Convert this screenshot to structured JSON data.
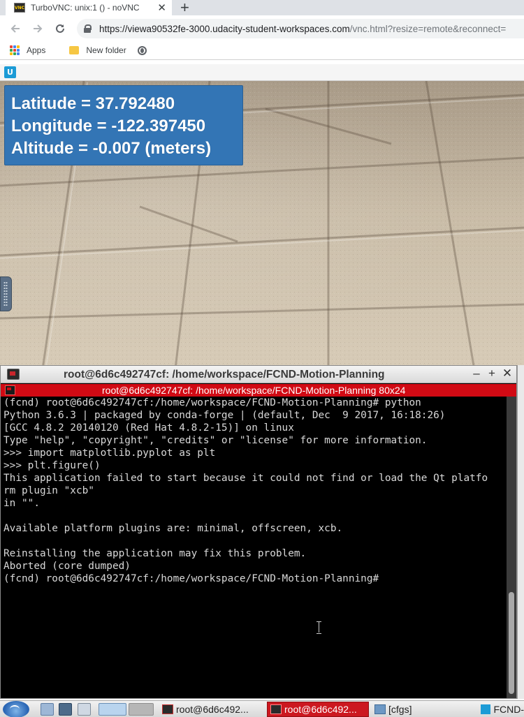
{
  "browser": {
    "tab_title": "TurboVNC: unix:1 () - noVNC",
    "tab_favicon_text": "VNC",
    "url_host": "https://viewa90532fe-3000.udacity-student-workspaces.com",
    "url_path": "/vnc.html?resize=remote&reconnect=",
    "bookmarks": [
      {
        "label": "Apps",
        "icon": "apps-grid-icon"
      },
      {
        "label": "New folder",
        "icon": "folder-icon"
      },
      {
        "label": "",
        "icon": "globe-icon"
      }
    ],
    "colors": {
      "tabstrip": "#dee1e6",
      "omnibox": "#f1f3f4"
    }
  },
  "novnc": {
    "logo_text": "U"
  },
  "simulator": {
    "gps": {
      "latitude": "Latitude = 37.792480",
      "longitude": "Longitude = -122.397450",
      "altitude": "Altitude = -0.007 (meters)"
    },
    "panel_color": "#3375b5"
  },
  "terminal": {
    "window_title": "root@6d6c492747cf: /home/workspace/FCND-Motion-Planning",
    "tab_title": "root@6d6c492747cf: /home/workspace/FCND-Motion-Planning 80x24",
    "tab_color": "#d10a14",
    "controls": {
      "minimize": "–",
      "maximize": "+",
      "close": "✕"
    },
    "lines": [
      "(fcnd) root@6d6c492747cf:/home/workspace/FCND-Motion-Planning# python",
      "Python 3.6.3 | packaged by conda-forge | (default, Dec  9 2017, 16:18:26)",
      "[GCC 4.8.2 20140120 (Red Hat 4.8.2-15)] on linux",
      "Type \"help\", \"copyright\", \"credits\" or \"license\" for more information.",
      ">>> import matplotlib.pyplot as plt",
      ">>> plt.figure()",
      "This application failed to start because it could not find or load the Qt platfo",
      "rm plugin \"xcb\"",
      "in \"\".",
      "",
      "Available platform plugins are: minimal, offscreen, xcb.",
      "",
      "Reinstalling the application may fix this problem.",
      "Aborted (core dumped)",
      "(fcnd) root@6d6c492747cf:/home/workspace/FCND-Motion-Planning# "
    ]
  },
  "taskbar": {
    "items": [
      {
        "label": "root@6d6c492...",
        "icon": "terminal-icon",
        "active": false
      },
      {
        "label": "root@6d6c492...",
        "icon": "terminal-icon",
        "active": true
      },
      {
        "label": "[cfgs]",
        "icon": "folder-icon",
        "active": false
      },
      {
        "label": "FCND-",
        "icon": "udacity-icon",
        "active": false
      }
    ]
  }
}
